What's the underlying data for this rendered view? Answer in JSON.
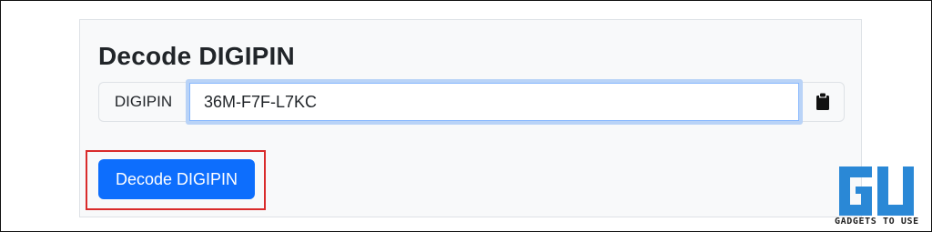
{
  "card": {
    "title": "Decode DIGIPIN"
  },
  "input_group": {
    "prefix_label": "DIGIPIN",
    "value": "36M-F7F-L7KC",
    "paste_icon": "clipboard-icon"
  },
  "decode_button": {
    "label": "Decode DIGIPIN",
    "highlight_color": "#d92b2b"
  },
  "watermark": {
    "brand_text": "GADGETS TO USE",
    "logo_color": "#2a88d6"
  },
  "colors": {
    "primary": "#0d6efd",
    "card_bg": "#f8f9fa",
    "focus_ring": "#b9d3f7"
  }
}
